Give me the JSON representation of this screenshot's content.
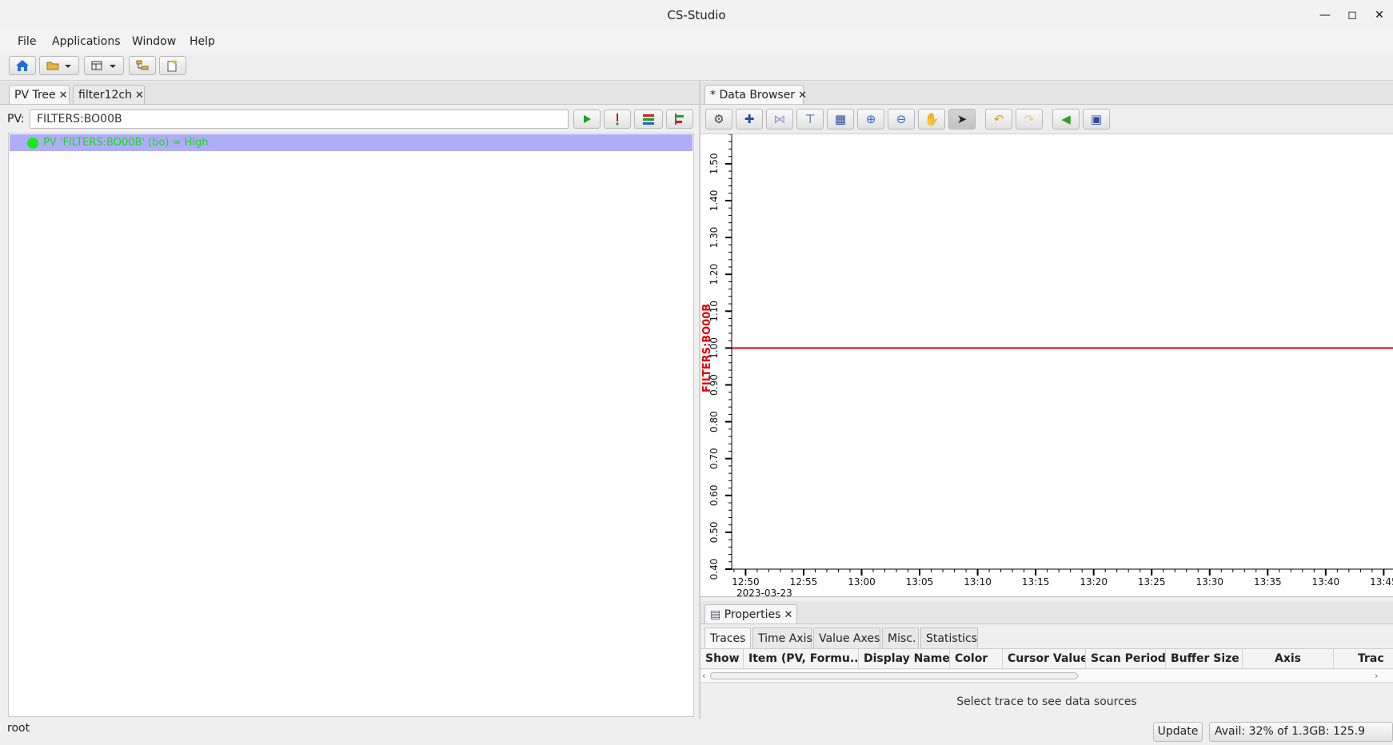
{
  "window": {
    "title": "CS-Studio"
  },
  "menu": {
    "items": [
      "File",
      "Applications",
      "Window",
      "Help"
    ]
  },
  "left": {
    "tabs": [
      {
        "label": "PV Tree"
      },
      {
        "label": "filter12ch"
      }
    ],
    "pv_label": "PV:",
    "pv_value": "FILTERS:BO00B",
    "tree_item": "PV 'FILTERS:BO00B' (bo)  =  High"
  },
  "right": {
    "tab": "* Data Browser",
    "properties_tab": "Properties",
    "subtabs": [
      "Traces",
      "Time Axis",
      "Value Axes",
      "Misc.",
      "Statistics"
    ],
    "columns": [
      "Show",
      "Item (PV, Formu...",
      "Display Name",
      "Color",
      "Cursor Value",
      "Scan Period",
      "Buffer Size",
      "Axis",
      "Trac"
    ],
    "select_message": "Select trace to see data sources"
  },
  "chart_data": {
    "type": "line",
    "ylabel": "FILTERS:BO00B",
    "ylim": [
      0.4,
      1.58
    ],
    "y_ticks": [
      "0.40",
      "0.50",
      "0.60",
      "0.70",
      "0.80",
      "0.90",
      "1.00",
      "1.10",
      "1.20",
      "1.30",
      "1.40",
      "1.50"
    ],
    "x_ticks": [
      "12:50",
      "12:55",
      "13:00",
      "13:05",
      "13:10",
      "13:15",
      "13:20",
      "13:25",
      "13:30",
      "13:35",
      "13:40",
      "13:45"
    ],
    "x_date": "2023-03-23",
    "xlim_minutes": [
      -1.2,
      55.8
    ],
    "series": [
      {
        "name": "FILTERS:BO00B",
        "color": "#e00000",
        "x_minutes": [
          -1.2,
          55.8
        ],
        "values": [
          1.0,
          1.0
        ]
      }
    ],
    "trace_color": "#e00000",
    "ylabel_color": "#e00000"
  },
  "status": {
    "user": "root",
    "update_label": "Update",
    "memory": "Avail: 32% of 1.3GB: 125.9"
  }
}
